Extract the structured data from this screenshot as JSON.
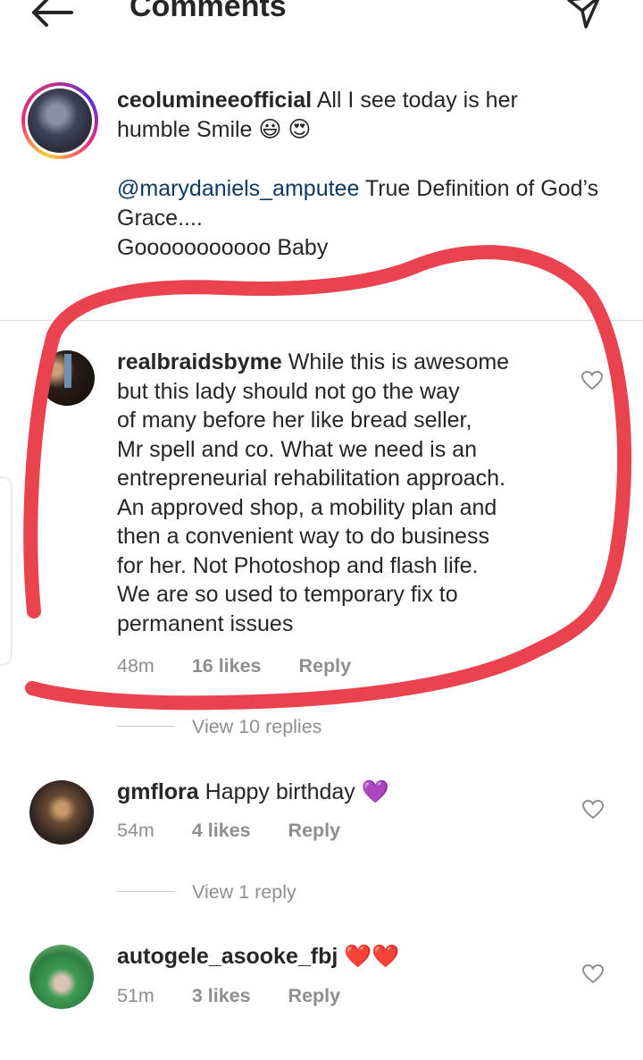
{
  "header": {
    "title": "Comments"
  },
  "caption": {
    "username": "ceolumineeofficial",
    "text": "All I see today is her humble Smile 😃 😍",
    "line2_mention": "@marydaniels_amputee",
    "line2_text": "True Definition of God’s Grace....",
    "line3": "Gooooooooooo Baby"
  },
  "comments": [
    {
      "username": "realbraidsbyme",
      "lines": [
        "While this is awesome",
        "but this lady should not go the way",
        "of many before her like bread seller,",
        "Mr spell and co. What we need is an",
        "entrepreneurial rehabilitation approach.",
        "An approved shop, a mobility plan and",
        "then a convenient way to do business",
        "for her. Not Photoshop and flash life.",
        "We are so used to temporary fix to",
        "permanent issues"
      ],
      "time": "48m",
      "likes": "16 likes",
      "reply": "Reply",
      "view_replies": "View 10 replies"
    },
    {
      "username": "gmflora",
      "text": "Happy birthday 💜",
      "time": "54m",
      "likes": "4 likes",
      "reply": "Reply",
      "view_replies": "View 1 reply"
    },
    {
      "username": "autogele_asooke_fbj",
      "text": "❤️❤️",
      "time": "51m",
      "likes": "3 likes",
      "reply": "Reply"
    }
  ],
  "colors": {
    "annotation_red": "#e8434e",
    "meta_gray": "#8e8e8e",
    "mention_blue": "#0b3a63"
  }
}
